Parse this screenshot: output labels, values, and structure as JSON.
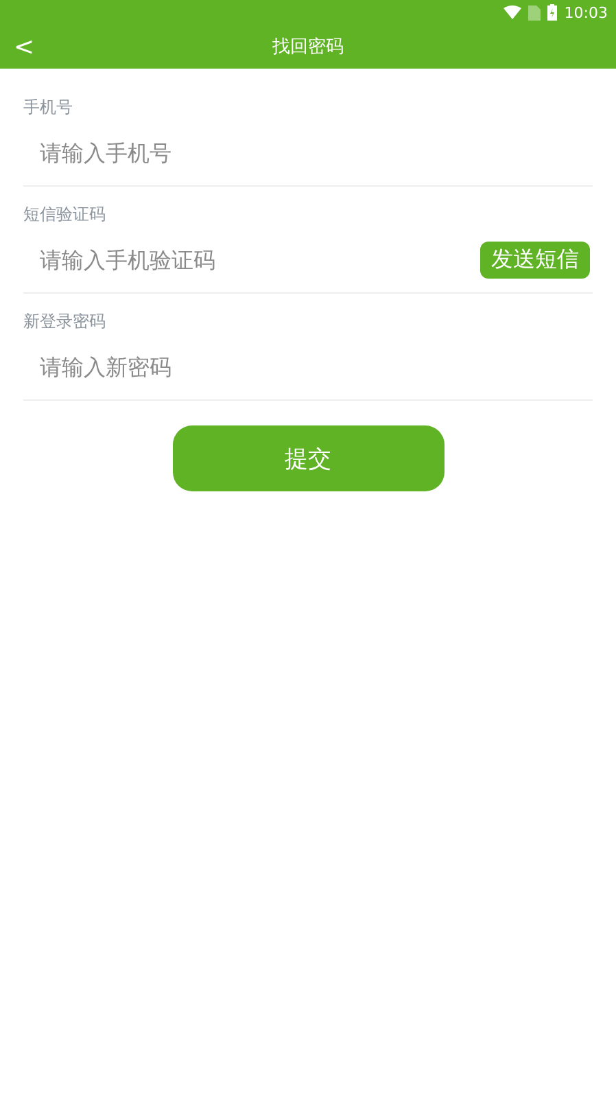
{
  "status_bar": {
    "time": "10:03"
  },
  "toolbar": {
    "back": "<",
    "title": "找回密码"
  },
  "fields": [
    {
      "kind": "text",
      "label": "手机号",
      "placeholder": "请输入手机号"
    },
    {
      "kind": "with_button",
      "label": "短信验证码",
      "placeholder": "请输入手机验证码",
      "button": "发送短信"
    },
    {
      "kind": "text",
      "label": "新登录密码",
      "placeholder": "请输入新密码"
    }
  ],
  "submit": "提交"
}
